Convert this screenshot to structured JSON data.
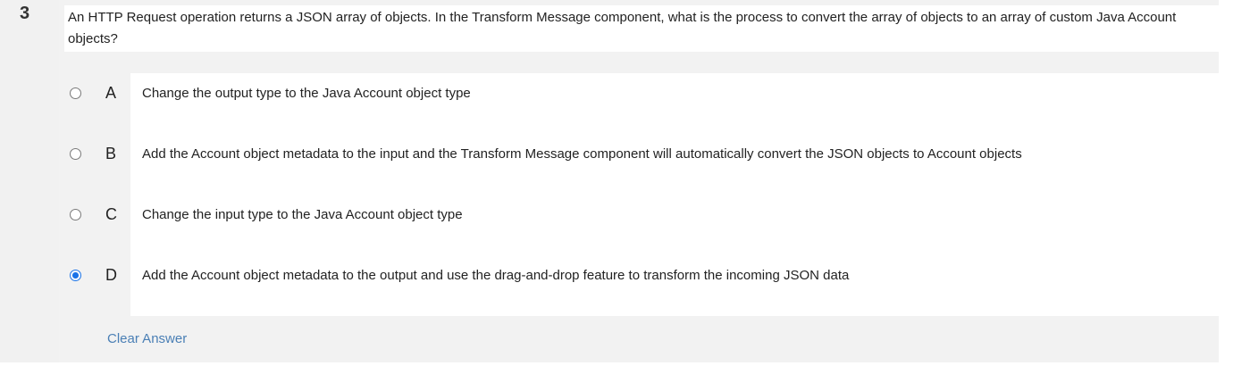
{
  "question": {
    "number": "3",
    "text": "An HTTP Request operation returns a JSON array of objects. In the Transform Message component, what is the process to convert the array of objects to an array of custom Java Account objects?"
  },
  "options": [
    {
      "letter": "A",
      "text": "Change the output type to the Java Account object type",
      "selected": false
    },
    {
      "letter": "B",
      "text": "Add the Account object metadata to the input and the Transform Message component will automatically convert the JSON objects to Account objects",
      "selected": false
    },
    {
      "letter": "C",
      "text": "Change the input type to the Java Account object type",
      "selected": false
    },
    {
      "letter": "D",
      "text": "Add the Account object metadata to the output and use the drag-and-drop feature to transform the incoming JSON data",
      "selected": true
    }
  ],
  "footer": {
    "clear_label": "Clear Answer"
  },
  "colors": {
    "accent": "#1a73e8",
    "link": "#4a7fb5",
    "panel": "#f2f2f2"
  }
}
